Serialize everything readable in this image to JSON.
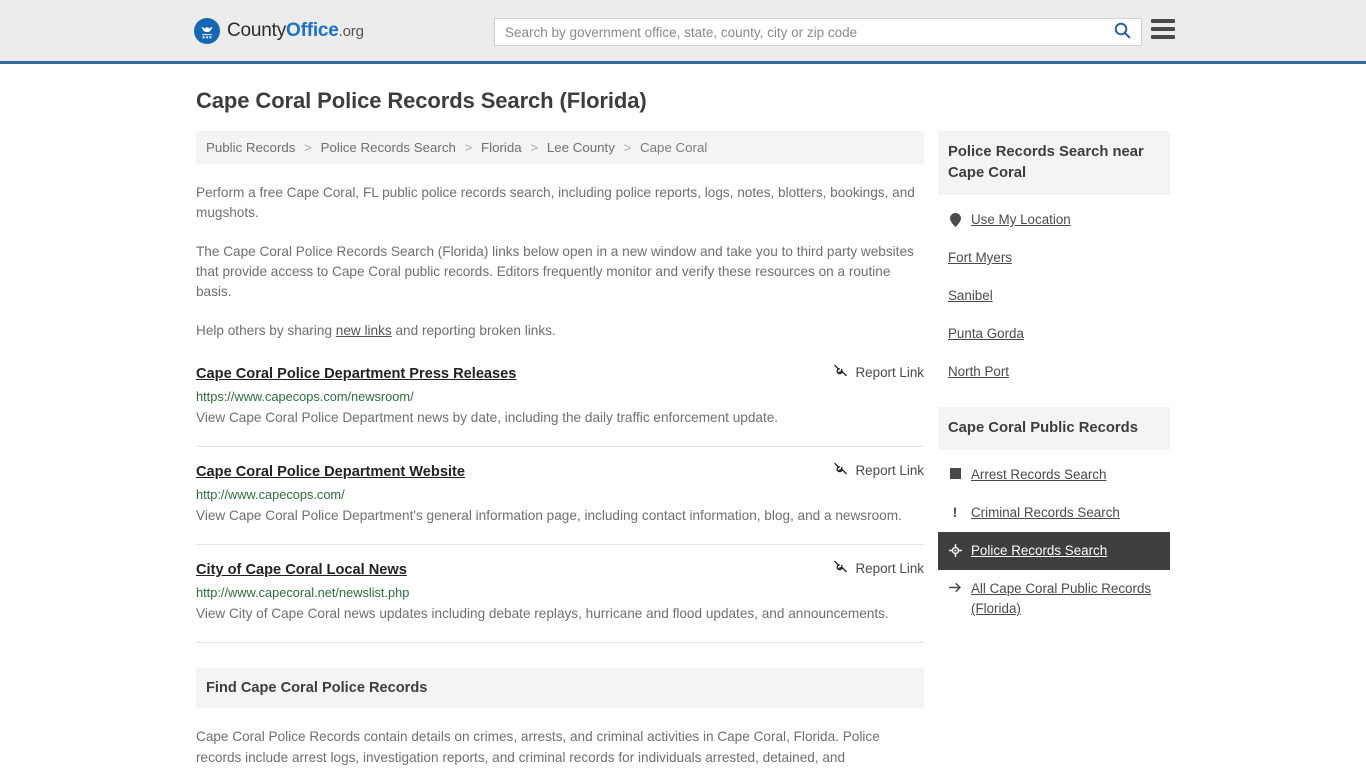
{
  "header": {
    "brand": {
      "county": "County",
      "office": "Office",
      "org": ".org",
      "icon": "eagle-seal-icon"
    },
    "search": {
      "placeholder": "Search by government office, state, county, city or zip code",
      "value": "",
      "button_icon": "search-icon"
    },
    "menu_icon": "hamburger-menu-icon",
    "accent_color": "#336b9e",
    "background_color": "#ececea"
  },
  "page": {
    "title": "Cape Coral Police Records Search (Florida)"
  },
  "breadcrumb": {
    "separator": ">",
    "items": [
      {
        "label": "Public Records",
        "current": false
      },
      {
        "label": "Police Records Search",
        "current": false
      },
      {
        "label": "Florida",
        "current": false
      },
      {
        "label": "Lee County",
        "current": false
      },
      {
        "label": "Cape Coral",
        "current": true
      }
    ]
  },
  "intro": {
    "paragraph_1": "Perform a free Cape Coral, FL public police records search, including police reports, logs, notes, blotters, bookings, and mugshots.",
    "paragraph_2": "The Cape Coral Police Records Search (Florida) links below open in a new window and take you to third party websites that provide access to Cape Coral public records. Editors frequently monitor and verify these resources on a routine basis.",
    "help_prefix": "Help others by sharing ",
    "help_link": "new links",
    "help_suffix": " and reporting broken links."
  },
  "report_link": {
    "label": "Report Link",
    "icon": "broken-link-icon"
  },
  "results": [
    {
      "title": "Cape Coral Police Department Press Releases",
      "url": "https://www.capecops.com/newsroom/",
      "description": "View Cape Coral Police Department news by date, including the daily traffic enforcement update."
    },
    {
      "title": "Cape Coral Police Department Website",
      "url": "http://www.capecops.com/",
      "description": "View Cape Coral Police Department's general information page, including contact information, blog, and a newsroom."
    },
    {
      "title": "City of Cape Coral Local News",
      "url": "http://www.capecoral.net/newslist.php",
      "description": "View City of Cape Coral news updates including debate replays, hurricane and flood updates, and announcements."
    }
  ],
  "find_section": {
    "heading": "Find Cape Coral Police Records",
    "body": "Cape Coral Police Records contain details on crimes, arrests, and criminal activities in Cape Coral, Florida. Police records include arrest logs, investigation reports, and criminal records for individuals arrested, detained, and"
  },
  "sidebar": {
    "near": {
      "heading": "Police Records Search near Cape Coral",
      "items": [
        {
          "label": "Use My Location",
          "icon": "map-pin-icon",
          "active": false
        },
        {
          "label": "Fort Myers",
          "icon": "",
          "active": false
        },
        {
          "label": "Sanibel",
          "icon": "",
          "active": false
        },
        {
          "label": "Punta Gorda",
          "icon": "",
          "active": false
        },
        {
          "label": "North Port",
          "icon": "",
          "active": false
        }
      ]
    },
    "public_records": {
      "heading": "Cape Coral Public Records",
      "items": [
        {
          "label": "Arrest Records Search",
          "icon": "square-icon",
          "active": false
        },
        {
          "label": "Criminal Records Search",
          "icon": "exclamation-icon",
          "active": false
        },
        {
          "label": "Police Records Search",
          "icon": "police-badge-icon",
          "active": true
        },
        {
          "label": "All Cape Coral Public Records (Florida)",
          "icon": "arrow-right-icon",
          "active": false
        }
      ]
    },
    "active_background_color": "#3f3f3f"
  }
}
